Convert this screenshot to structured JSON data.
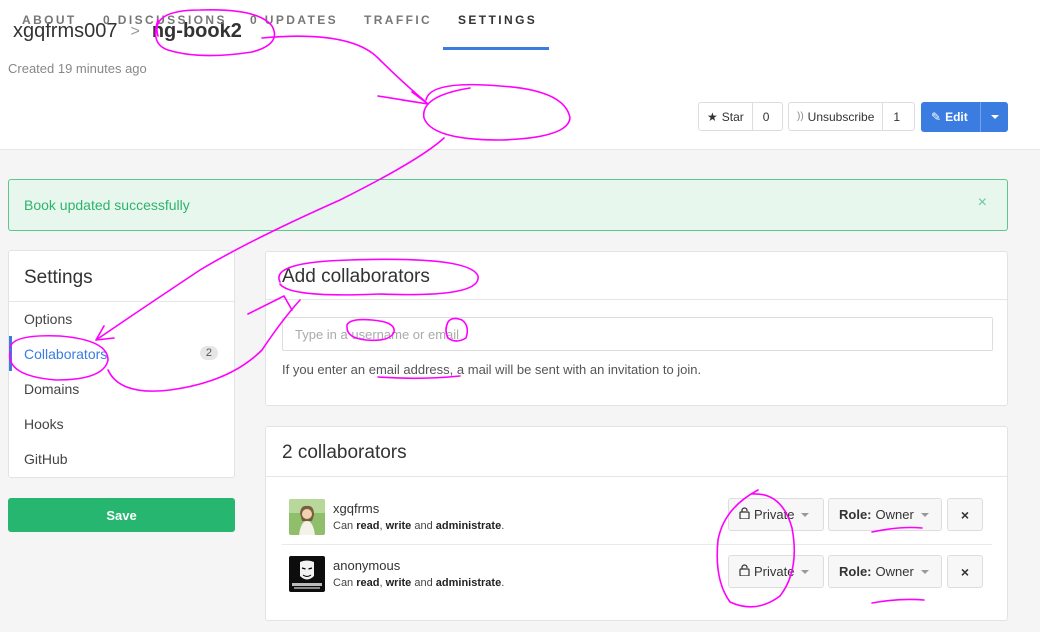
{
  "header": {
    "owner": "xgqfrms007",
    "separator": ">",
    "book": "ng-book2",
    "created": "Created 19 minutes ago"
  },
  "tabs": [
    {
      "label": "About"
    },
    {
      "label": "0 Discussions"
    },
    {
      "label": "0 Updates"
    },
    {
      "label": "Traffic"
    },
    {
      "label": "Settings",
      "active": true
    }
  ],
  "actions": {
    "star_label": "Star",
    "star_count": "0",
    "unsubscribe_label": "Unsubscribe",
    "unsubscribe_count": "1",
    "edit_label": "Edit"
  },
  "alert": {
    "message": "Book updated successfully",
    "close": "×"
  },
  "sidebar": {
    "title": "Settings",
    "items": [
      {
        "label": "Options"
      },
      {
        "label": "Collaborators",
        "badge": "2",
        "active": true
      },
      {
        "label": "Domains"
      },
      {
        "label": "Hooks"
      },
      {
        "label": "GitHub"
      }
    ],
    "save_label": "Save"
  },
  "add_collaborators": {
    "title": "Add collaborators",
    "placeholder": "Type in a username or email",
    "help_prefix": "If you enter an ",
    "help_link": "email address",
    "help_suffix": ", a mail will be sent with an invitation to join."
  },
  "collaborators": {
    "title": "2 collaborators",
    "list": [
      {
        "name": "xgqfrms",
        "desc_prefix": "Can ",
        "perm1": "read",
        "sep1": ", ",
        "perm2": "write",
        "sep2": " and ",
        "perm3": "administrate",
        "desc_suffix": ".",
        "privacy": "Private",
        "role_label": "Role:",
        "role_value": "Owner",
        "remove": "×"
      },
      {
        "name": "anonymous",
        "desc_prefix": "Can ",
        "perm1": "read",
        "sep1": ", ",
        "perm2": "write",
        "sep2": " and ",
        "perm3": "administrate",
        "desc_suffix": ".",
        "privacy": "Private",
        "role_label": "Role:",
        "role_value": "Owner",
        "remove": "×"
      }
    ]
  },
  "colors": {
    "accent": "#3a7ce0",
    "success": "#26b66f",
    "annotation": "#ff00ff"
  }
}
